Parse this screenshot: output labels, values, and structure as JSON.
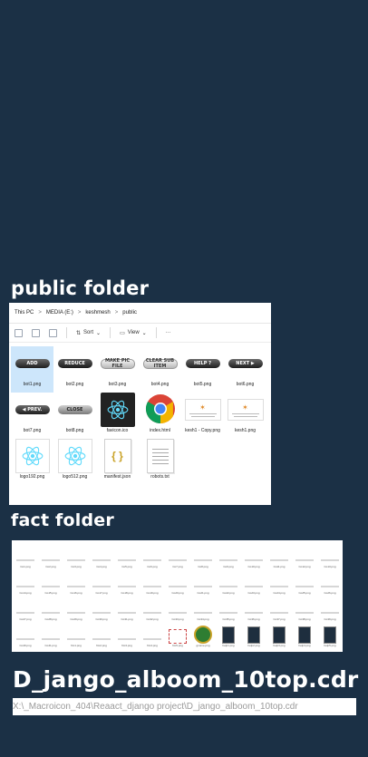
{
  "labels": {
    "public_folder": "public folder",
    "fact_folder": "fact folder",
    "cdr_file": "D_jango_alboom_10top.cdr"
  },
  "explorer": {
    "breadcrumb": [
      "This PC",
      "MEDIA (E:)",
      "keshmesh",
      "public"
    ],
    "toolbar": {
      "sort": "Sort",
      "view": "View",
      "more": "···"
    },
    "files": [
      {
        "name": "bot1.png",
        "kind": "button",
        "text": "ADD",
        "style": "dark",
        "selected": true
      },
      {
        "name": "bot2.png",
        "kind": "button",
        "text": "REDUCE",
        "style": "red"
      },
      {
        "name": "bot3.png",
        "kind": "button",
        "text": "MAKE PIC FILE",
        "style": "light"
      },
      {
        "name": "bot4.png",
        "kind": "button",
        "text": "CLEAR SUB ITEM",
        "style": "light"
      },
      {
        "name": "bot5.png",
        "kind": "button",
        "text": "HELP ?",
        "style": "dark"
      },
      {
        "name": "bot6.png",
        "kind": "button",
        "text": "NEXT ▶",
        "style": "dark"
      },
      {
        "name": "bot7.png",
        "kind": "button",
        "text": "◀ PREV.",
        "style": "dark"
      },
      {
        "name": "bot8.png",
        "kind": "button",
        "text": "CLOSE",
        "style": "grey"
      },
      {
        "name": "favicon.ico",
        "kind": "react-dark"
      },
      {
        "name": "index.html",
        "kind": "chrome"
      },
      {
        "name": "kesh1 - Copy.png",
        "kind": "kesh"
      },
      {
        "name": "kesh1.png",
        "kind": "kesh"
      },
      {
        "name": "logo192.png",
        "kind": "react-light"
      },
      {
        "name": "logo512.png",
        "kind": "react-light"
      },
      {
        "name": "manifest.json",
        "kind": "json"
      },
      {
        "name": "robots.txt",
        "kind": "text"
      }
    ]
  },
  "fact": {
    "files": [
      "Co1.png",
      "Co2.png",
      "Co3.png",
      "Co4.png",
      "Co5.png",
      "Co6.png",
      "Co7.png",
      "Co8.png",
      "Co9.png",
      "Co10.png",
      "Co11.png",
      "Co12.png",
      "Co13.png",
      "Co14.png",
      "Co15.png",
      "Co16.png",
      "Co17.png",
      "Co18.png",
      "Co19.png",
      "Co20.png",
      "Co21.png",
      "Co22.png",
      "Co23.png",
      "Co24.png",
      "Co25.png",
      "Co26.png",
      "Co27.png",
      "Co28.png",
      "Co29.png",
      "Co30.png",
      "Co31.png",
      "Co32.png",
      "Co33.png",
      "Co34.png",
      "Co35.png",
      "Co36.png",
      "Co37.png",
      "Co38.png",
      "Co39.png",
      "Co40.png",
      "Co41.png",
      "fim1.png",
      "fim2.png",
      "fim3.png",
      "fim4.png",
      "fim5.png",
      "gnome.png",
      "help1.png",
      "help2.png",
      "help3.png",
      "help4.png",
      "help5.png",
      "help6.png",
      "help7.png"
    ]
  },
  "path": "X:\\_Macroicon_404\\Reaact_django project\\D_jango_alboom_10top.cdr",
  "colors": {
    "background": "#1b3045",
    "selected": "#cde6fb"
  }
}
